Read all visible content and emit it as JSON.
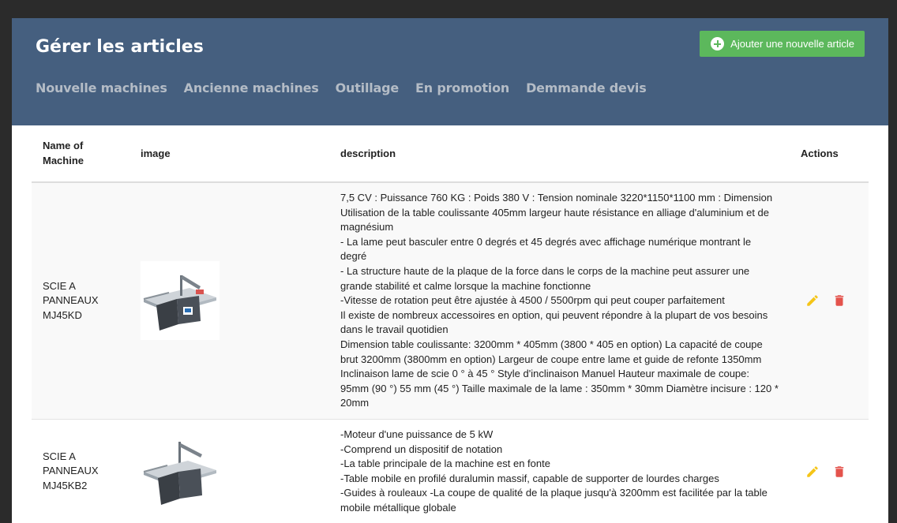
{
  "header": {
    "title": "Gérer les articles",
    "add_button_label": "Ajouter une nouvelle article",
    "nav": [
      "Nouvelle machines",
      "Ancienne machines",
      "Outillage",
      "En promotion",
      "Demmande devis"
    ]
  },
  "table": {
    "columns": {
      "name": "Name of Machine",
      "image": "image",
      "description": "description",
      "actions": "Actions"
    },
    "rows": [
      {
        "name": "SCIE A PANNEAUX MJ45KD",
        "description": [
          "7,5 CV : Puissance 760 KG : Poids 380 V : Tension nominale 3220*1150*1100 mm : Dimension Utilisation de la table coulissante 405mm largeur haute résistance en alliage d'aluminium et de magnésium",
          "- La lame peut basculer entre 0 degrés et 45 degrés avec affichage numérique montrant le degré",
          "- La structure haute de la plaque de la force dans le corps de la machine peut assurer une grande stabilité et calme lorsque la machine fonctionne",
          "-Vitesse de rotation peut être ajustée à 4500 / 5500rpm qui peut couper parfaitement",
          "Il existe de nombreux accessoires en option, qui peuvent répondre à la plupart de vos besoins dans le travail quotidien",
          "Dimension table coulissante: 3200mm * 405mm (3800 * 405 en option) La capacité de coupe brut 3200mm (3800mm en option) Largeur de coupe entre lame et guide de refonte 1350mm Inclinaison lame de scie 0 ° à 45 ° Style d'inclinaison Manuel Hauteur maximale de coupe: 95mm (90 °) 55 mm (45 °) Taille maximale de la lame : 350mm * 30mm Diamètre incisure : 120 * 20mm"
        ]
      },
      {
        "name": "SCIE A PANNEAUX MJ45KB2",
        "description": [
          "-Moteur d'une puissance de 5 kW",
          "-Comprend un dispositif de notation",
          "-La table principale de la machine est en fonte",
          "-Table mobile en profilé duralumin massif, capable de supporter de lourdes charges",
          "-Guides à rouleaux -La coupe de qualité de la plaque jusqu'à 3200mm est facilitée par la table mobile métallique globale"
        ]
      }
    ]
  },
  "colors": {
    "header_bg": "#455f7f",
    "nav_text": "#b4bcc6",
    "add_button": "#5cb85c",
    "edit_icon": "#f5c518",
    "delete_icon": "#e4534c"
  },
  "icons": {
    "add": "plus-circle-icon",
    "edit": "pencil-icon",
    "delete": "trash-icon"
  }
}
